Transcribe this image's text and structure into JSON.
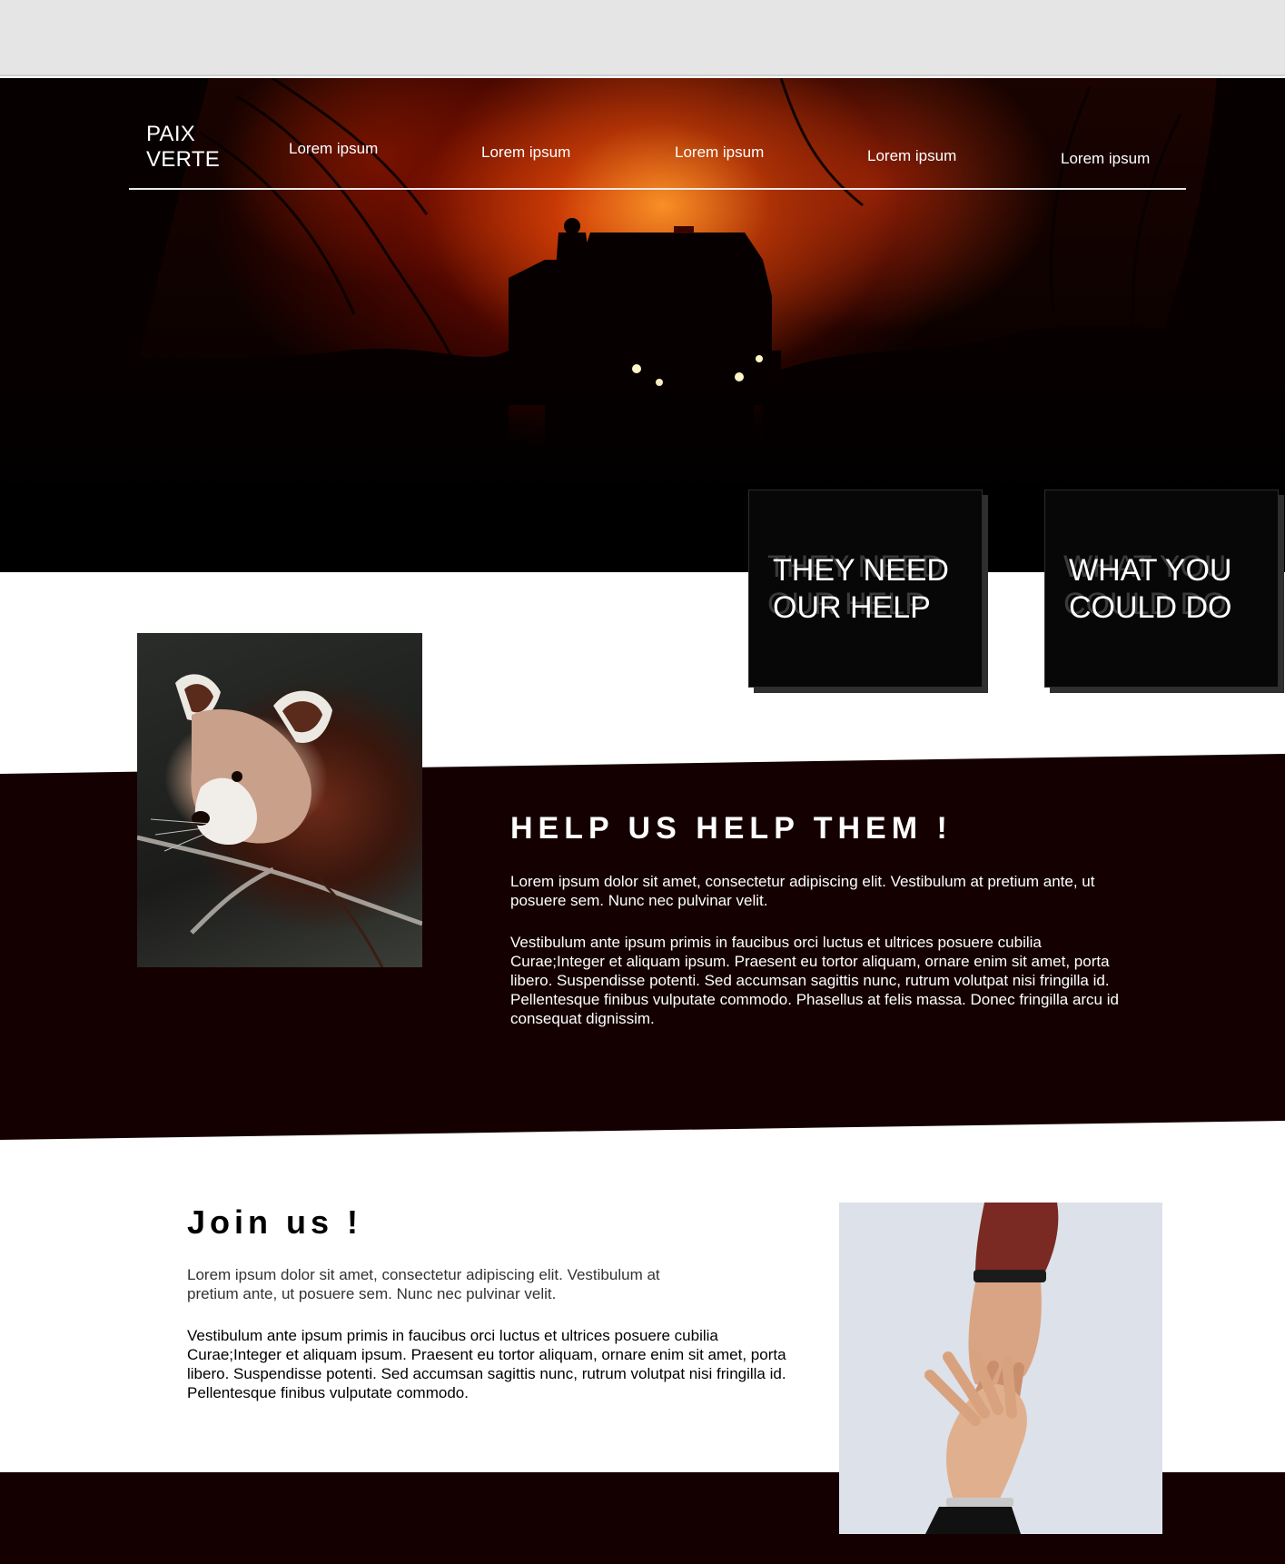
{
  "header": {
    "brand_line1": "PAIX",
    "brand_line2": "VERTE",
    "nav": [
      "Lorem ipsum",
      "Lorem ipsum",
      "Lorem ipsum",
      "Lorem ipsum",
      "Lorem ipsum"
    ]
  },
  "cards": [
    {
      "line1": "THEY NEED",
      "line2": "OUR HELP"
    },
    {
      "line1": "WHAT YOU",
      "line2": "COULD DO"
    }
  ],
  "help": {
    "title": "HELP US HELP THEM !",
    "intro": "Lorem ipsum dolor sit amet, consectetur adipiscing elit. Vestibulum at pretium ante, ut posuere sem. Nunc nec pulvinar velit.",
    "body": "Vestibulum ante ipsum primis in faucibus orci luctus et ultrices posuere cubilia Curae;Integer et aliquam ipsum. Praesent eu tortor aliquam, ornare enim sit amet, porta libero. Suspendisse potenti. Sed accumsan sagittis nunc, rutrum volutpat nisi fringilla id. Pellentesque finibus vulputate commodo. Phasellus at felis massa. Donec fringilla arcu id consequat dignissim."
  },
  "join": {
    "title": "Join us !",
    "intro": "Lorem ipsum dolor sit amet, consectetur adipiscing elit. Vestibulum at pretium ante, ut posuere sem. Nunc nec pulvinar velit.",
    "body": "Vestibulum ante ipsum primis in faucibus orci luctus et ultrices posuere cubilia Curae;Integer et aliquam ipsum. Praesent eu tortor aliquam, ornare enim sit amet, porta libero. Suspendisse potenti. Sed accumsan sagittis nunc, rutrum volutpat nisi fringilla id. Pellentesque finibus vulputate commodo."
  },
  "images": {
    "hero": "wildfire-firetruck-photo",
    "panda": "red-panda-photo",
    "hands": "reaching-hands-photo"
  },
  "colors": {
    "dark_band": "#140000",
    "fire_orange": "#e8501a",
    "card_bg": "#070707"
  }
}
